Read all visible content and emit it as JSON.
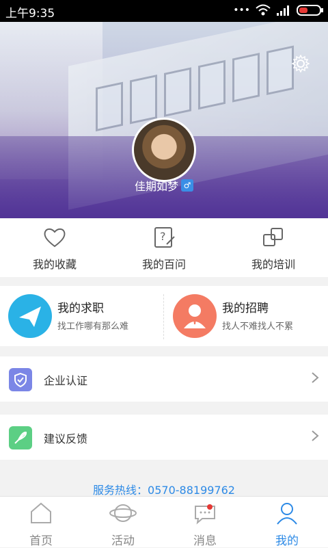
{
  "status": {
    "time": "上午9:35"
  },
  "profile": {
    "name": "佳期如梦",
    "gender": "♂"
  },
  "quick": [
    {
      "label": "我的收藏"
    },
    {
      "label": "我的百问"
    },
    {
      "label": "我的培训"
    }
  ],
  "cards": {
    "job": {
      "title": "我的求职",
      "sub": "找工作哪有那么难"
    },
    "recruit": {
      "title": "我的招聘",
      "sub": "找人不难找人不累"
    }
  },
  "rows": {
    "enterprise": "企业认证",
    "feedback": "建议反馈"
  },
  "hotline": "服务热线：0570-88199762",
  "tabs": [
    {
      "label": "首页"
    },
    {
      "label": "活动"
    },
    {
      "label": "消息"
    },
    {
      "label": "我的"
    }
  ],
  "colors": {
    "accent": "#2d8ae6",
    "job": "#2ab2e6",
    "recruit": "#f47b63",
    "enterprise": "#7b86e6",
    "feedback": "#5ccf84"
  }
}
